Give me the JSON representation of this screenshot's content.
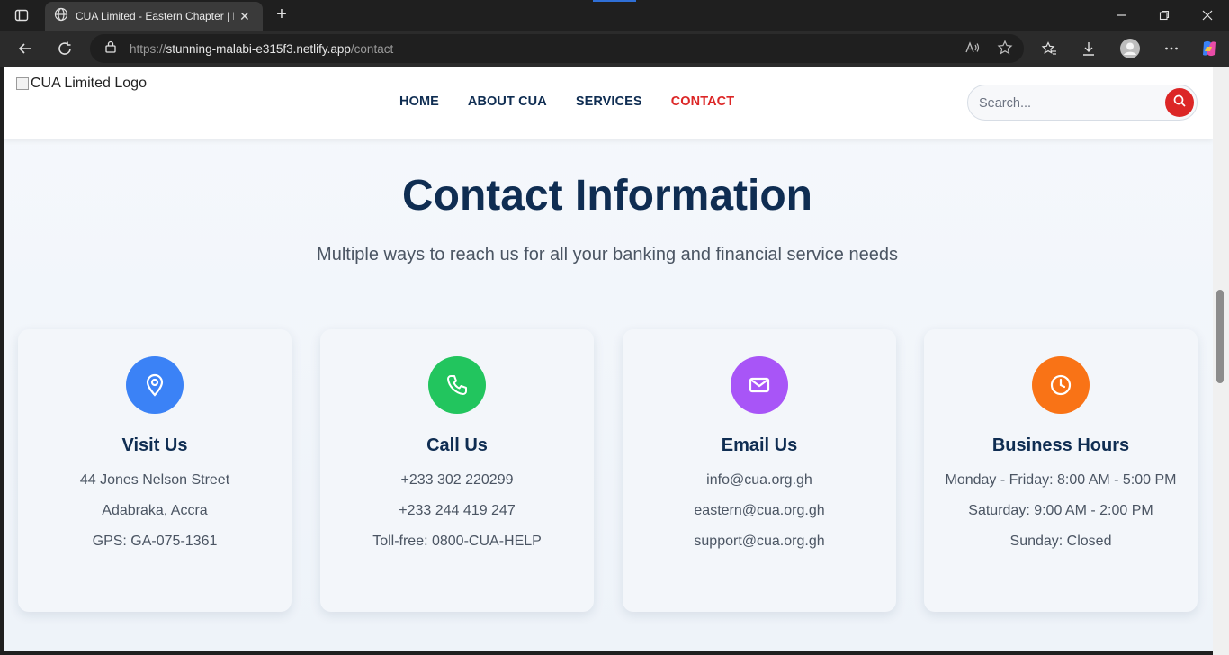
{
  "browser": {
    "tab_title": "CUA Limited - Eastern Chapter | E",
    "url_prefix": "https://",
    "url_host": "stunning-malabi-e315f3.netlify.app",
    "url_path": "/contact"
  },
  "header": {
    "logo_alt": "CUA Limited Logo",
    "nav": [
      {
        "label": "HOME"
      },
      {
        "label": "ABOUT CUA"
      },
      {
        "label": "SERVICES"
      },
      {
        "label": "CONTACT"
      }
    ],
    "search_placeholder": "Search..."
  },
  "main": {
    "title": "Contact Information",
    "subtitle": "Multiple ways to reach us for all your banking and financial service needs",
    "cards": [
      {
        "title": "Visit Us",
        "icon": "map-pin-icon",
        "color": "#3b82f6",
        "lines": [
          "44 Jones Nelson Street",
          "Adabraka, Accra",
          "GPS: GA-075-1361"
        ]
      },
      {
        "title": "Call Us",
        "icon": "phone-icon",
        "color": "#22c55e",
        "lines": [
          "+233 302 220299",
          "+233 244 419 247",
          "Toll-free: 0800-CUA-HELP"
        ]
      },
      {
        "title": "Email Us",
        "icon": "mail-icon",
        "color": "#a855f7",
        "lines": [
          "info@cua.org.gh",
          "eastern@cua.org.gh",
          "support@cua.org.gh"
        ]
      },
      {
        "title": "Business Hours",
        "icon": "clock-icon",
        "color": "#f97316",
        "lines": [
          "Monday - Friday: 8:00 AM - 5:00 PM",
          "Saturday: 9:00 AM - 2:00 PM",
          "Sunday: Closed"
        ]
      }
    ]
  },
  "colors": {
    "brand_navy": "#0f2d52",
    "accent_red": "#dc2626"
  }
}
